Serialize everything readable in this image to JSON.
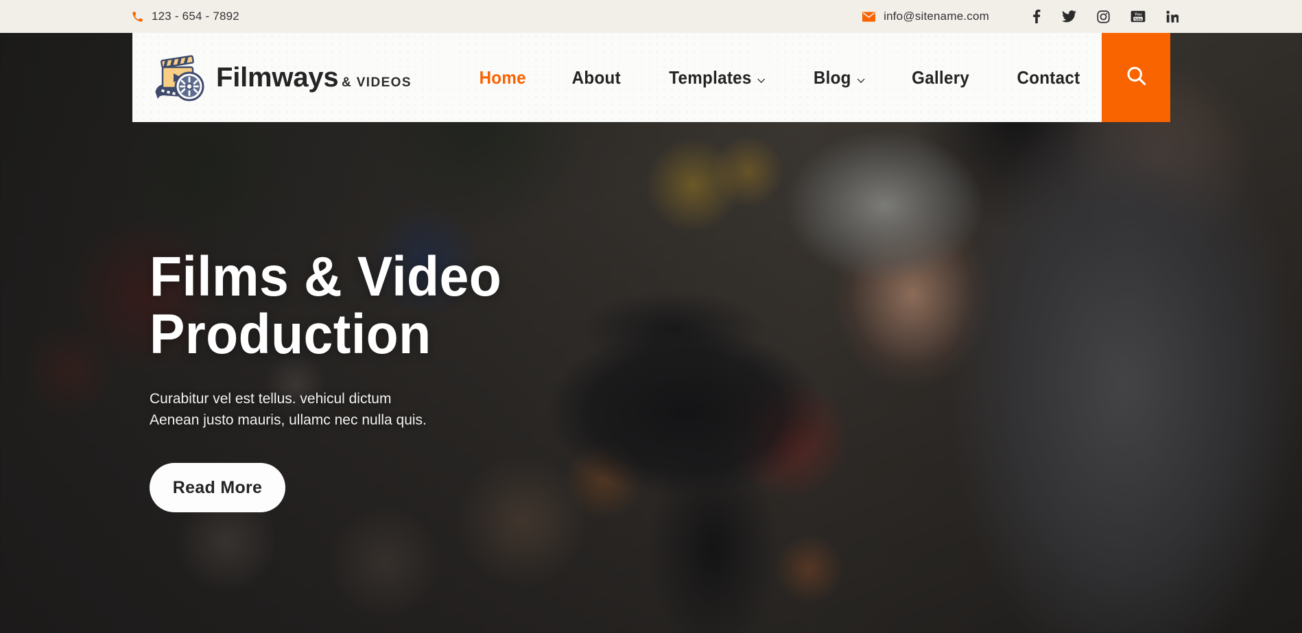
{
  "topbar": {
    "phone_icon": "phone-icon",
    "phone": "123 - 654 - 7892",
    "email_icon": "envelope-icon",
    "email": "info@sitename.com",
    "socials": [
      {
        "name": "facebook-icon",
        "label": "Facebook"
      },
      {
        "name": "twitter-icon",
        "label": "Twitter"
      },
      {
        "name": "instagram-icon",
        "label": "Instagram"
      },
      {
        "name": "youtube-icon",
        "label": "YouTube"
      },
      {
        "name": "linkedin-icon",
        "label": "LinkedIn"
      }
    ]
  },
  "header": {
    "logo": {
      "icon": "film-clapperboard-reel-icon",
      "title": "Filmways",
      "subtitle": "& VIDEOS"
    },
    "nav": [
      {
        "label": "Home",
        "active": true,
        "dropdown": false
      },
      {
        "label": "About",
        "active": false,
        "dropdown": false
      },
      {
        "label": "Templates",
        "active": false,
        "dropdown": true
      },
      {
        "label": "Blog",
        "active": false,
        "dropdown": true
      },
      {
        "label": "Gallery",
        "active": false,
        "dropdown": false
      },
      {
        "label": "Contact",
        "active": false,
        "dropdown": false
      }
    ],
    "search_icon": "search-icon",
    "dropdown_icon": "chevron-down-icon"
  },
  "hero": {
    "title_line1": "Films & Video",
    "title_line2": "Production",
    "subtitle_line1": "Curabitur vel est tellus. vehicul dictum",
    "subtitle_line2": "Aenean justo mauris, ullamc nec nulla quis.",
    "button_label": "Read More",
    "background_alt": "Cameraman filming with a camcorder in a crowd"
  },
  "colors": {
    "accent_orange": "#f96300",
    "topbar_bg": "#f2efe9",
    "header_bg": "#fbfbfa",
    "text_dark": "#232323",
    "text_light": "#ffffff"
  }
}
